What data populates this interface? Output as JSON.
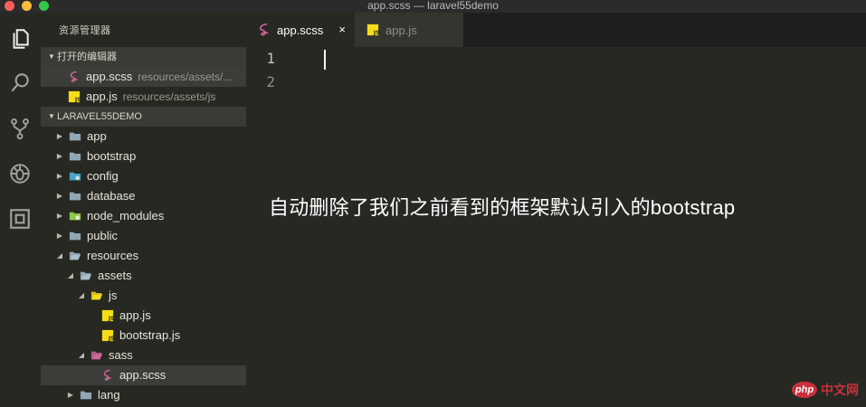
{
  "window": {
    "title": "app.scss — laravel55demo"
  },
  "activity_bar": [
    {
      "name": "explorer-icon"
    },
    {
      "name": "search-icon"
    },
    {
      "name": "source-control-icon"
    },
    {
      "name": "debug-icon"
    },
    {
      "name": "extensions-icon"
    }
  ],
  "sidebar": {
    "title": "资源管理器",
    "open_editors": {
      "header": "打开的编辑器",
      "items": [
        {
          "name": "app.scss",
          "path": "resources/assets/...",
          "icon": "sass-icon"
        },
        {
          "name": "app.js",
          "path": "resources/assets/js",
          "icon": "js-icon"
        }
      ]
    },
    "project": {
      "header": "LARAVEL55DEMO",
      "items": [
        {
          "label": "app",
          "type": "folder",
          "state": "collapsed"
        },
        {
          "label": "bootstrap",
          "type": "folder",
          "state": "collapsed"
        },
        {
          "label": "config",
          "type": "config-folder",
          "state": "collapsed"
        },
        {
          "label": "database",
          "type": "folder",
          "state": "collapsed"
        },
        {
          "label": "node_modules",
          "type": "node-folder",
          "state": "collapsed"
        },
        {
          "label": "public",
          "type": "folder",
          "state": "collapsed"
        },
        {
          "label": "resources",
          "type": "folder-open",
          "state": "expanded"
        },
        {
          "label": "assets",
          "type": "folder-open",
          "state": "expanded"
        },
        {
          "label": "js",
          "type": "js-folder-open",
          "state": "expanded"
        },
        {
          "label": "app.js",
          "type": "js-file"
        },
        {
          "label": "bootstrap.js",
          "type": "js-file"
        },
        {
          "label": "sass",
          "type": "sass-folder-open",
          "state": "expanded"
        },
        {
          "label": "app.scss",
          "type": "sass-file",
          "selected": true
        },
        {
          "label": "lang",
          "type": "folder",
          "state": "collapsed"
        }
      ]
    }
  },
  "tabs": [
    {
      "label": "app.scss",
      "icon": "sass-icon",
      "active": true,
      "close": "×"
    },
    {
      "label": "app.js",
      "icon": "js-icon",
      "active": false
    }
  ],
  "editor": {
    "line_numbers": [
      "1",
      "2"
    ]
  },
  "annotation": "自动删除了我们之前看到的框架默认引入的bootstrap",
  "watermark": {
    "badge": "php",
    "text": "中文网"
  },
  "colors": {
    "sass": "#cd6799",
    "js": "#f5de19",
    "folder": "#8fa6b5",
    "config": "#4ca3c6",
    "node": "#8cc84b"
  }
}
